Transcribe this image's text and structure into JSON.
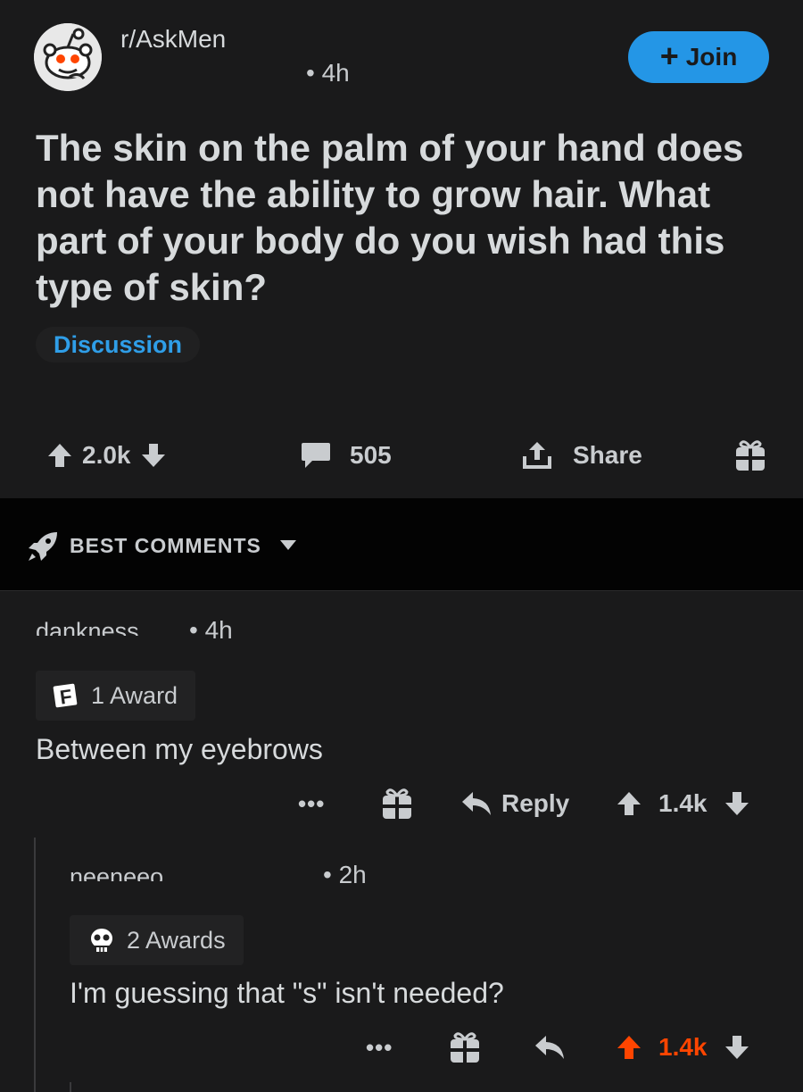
{
  "post": {
    "subreddit": "r/AskMen",
    "time": "• 4h",
    "join_label": "Join",
    "title": "The skin on the palm of your hand does not have the ability to grow hair. What part of your body do you wish had this type of skin?",
    "flair": "Discussion",
    "score": "2.0k",
    "comment_count": "505",
    "share_label": "Share"
  },
  "sort": {
    "label": "BEST COMMENTS"
  },
  "comments": [
    {
      "user": "dankness",
      "time": "• 4h",
      "awards": "1 Award",
      "body": "Between my eyebrows",
      "more": "•••",
      "reply_label": "Reply",
      "score": "1.4k"
    },
    {
      "user": "neeneeo",
      "time": "• 2h",
      "awards": "2 Awards",
      "body": "I'm guessing that \"s\" isn't needed?",
      "more": "•••",
      "score": "1.4k",
      "upvoted": true
    }
  ],
  "colors": {
    "background": "#1a1a1b",
    "accent_blue": "#2496e6",
    "flair_blue": "#2f9ee8",
    "upvote_orange": "#ff4500",
    "text": "#d7dadc"
  },
  "icons": [
    "reddit-avatar-icon",
    "upvote-icon",
    "downvote-icon",
    "comment-icon",
    "share-icon",
    "gift-icon",
    "rocket-icon",
    "reply-icon",
    "award-icon"
  ]
}
